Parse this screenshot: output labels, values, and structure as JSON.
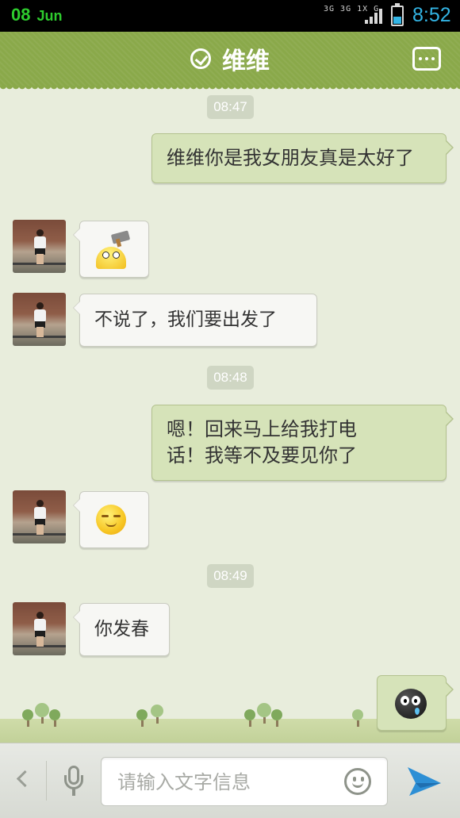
{
  "status_bar": {
    "date_day": "08",
    "date_month": "Jun",
    "network": "3G 3G 1X G",
    "time": "8:52",
    "accent_color": "#33b5e5"
  },
  "header": {
    "title": "维维",
    "verified_icon": "check-circle-icon",
    "more_icon": "more-dots-icon",
    "background": "#8aa94a"
  },
  "messages": [
    {
      "type": "time",
      "text": "08:47"
    },
    {
      "type": "out",
      "text": "维维你是我女朋友真是太好了"
    },
    {
      "type": "in",
      "kind": "emoji",
      "emoji": "hammer-face-emoji"
    },
    {
      "type": "in",
      "kind": "text",
      "text": "不说了，我们要出发了"
    },
    {
      "type": "time",
      "text": "08:48"
    },
    {
      "type": "out",
      "text": "嗯！回来马上给我打电话！我等不及要见你了"
    },
    {
      "type": "in",
      "kind": "emoji",
      "emoji": "shy-smile-emoji"
    },
    {
      "type": "time",
      "text": "08:49"
    },
    {
      "type": "in",
      "kind": "text",
      "text": "你发春"
    },
    {
      "type": "out",
      "kind": "emoji",
      "emoji": "crying-ball-emoji"
    }
  ],
  "input_bar": {
    "placeholder": "请输入文字信息",
    "back_icon": "chevron-left-icon",
    "voice_icon": "microphone-icon",
    "emoji_icon": "smiley-icon",
    "send_icon": "send-arrow-icon",
    "send_color": "#2d8fd5"
  }
}
